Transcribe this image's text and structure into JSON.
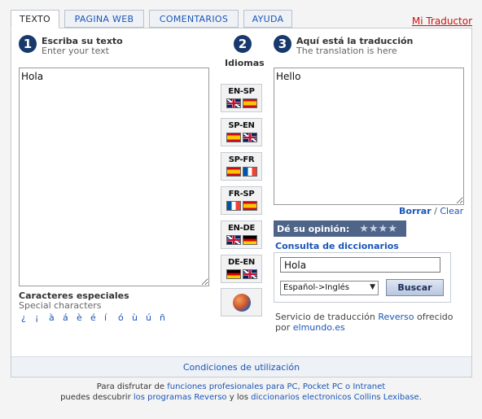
{
  "tabs": [
    "TEXTO",
    "PAGINA WEB",
    "COMENTARIOS",
    "AYUDA"
  ],
  "brand_link": "Mi Traductor",
  "step1": {
    "num": "1",
    "title": "Escriba su texto",
    "subtitle": "Enter your text",
    "text": "Hola"
  },
  "step2": {
    "num": "2",
    "title": "Idiomas"
  },
  "step3": {
    "num": "3",
    "title": "Aquí está la traducción",
    "subtitle": "The translation is here",
    "text": "Hello"
  },
  "lang_buttons": [
    "EN-SP",
    "SP-EN",
    "SP-FR",
    "FR-SP",
    "EN-DE",
    "DE-EN"
  ],
  "clear": {
    "borrar": "Borrar",
    "sep": "/",
    "clear": "Clear"
  },
  "opinion": {
    "label": "Dé su opinión:",
    "stars": "★★★★"
  },
  "dictionary": {
    "title": "Consulta de diccionarios",
    "query": "Hola",
    "selected": "Español->Inglés",
    "search_label": "Buscar"
  },
  "special": {
    "title": "Caracteres especiales",
    "subtitle": "Special characters",
    "chars": [
      "¿",
      "¡",
      "à",
      "á",
      "è",
      "é",
      "í",
      "ó",
      "ù",
      "ú",
      "ñ"
    ]
  },
  "service": {
    "line1_a": "Servicio de traducción",
    "line1_link": "Reverso",
    "line1_b": "ofrecido",
    "line2_a": "por",
    "line2_link": "elmundo.es"
  },
  "conditions": "Condiciones de utilización",
  "bottom": {
    "l1_a": "Para disfrutar de",
    "l1_link": "funciones profesionales para PC, Pocket PC o Intranet",
    "l2_a": "puedes descubrir",
    "l2_link1": "los programas Reverso",
    "l2_b": "y los",
    "l2_link2": "diccionarios electronicos Collins Lexibase",
    "l2_c": "."
  },
  "colors": {
    "accent": "#17396b",
    "link": "#1a56b8",
    "brand": "#cc1111",
    "opinion_bg": "#4e6489"
  },
  "icons": {
    "globe": "globe-icon",
    "flags": [
      "flag-uk-icon",
      "flag-es-icon",
      "flag-fr-icon",
      "flag-de-icon"
    ]
  }
}
